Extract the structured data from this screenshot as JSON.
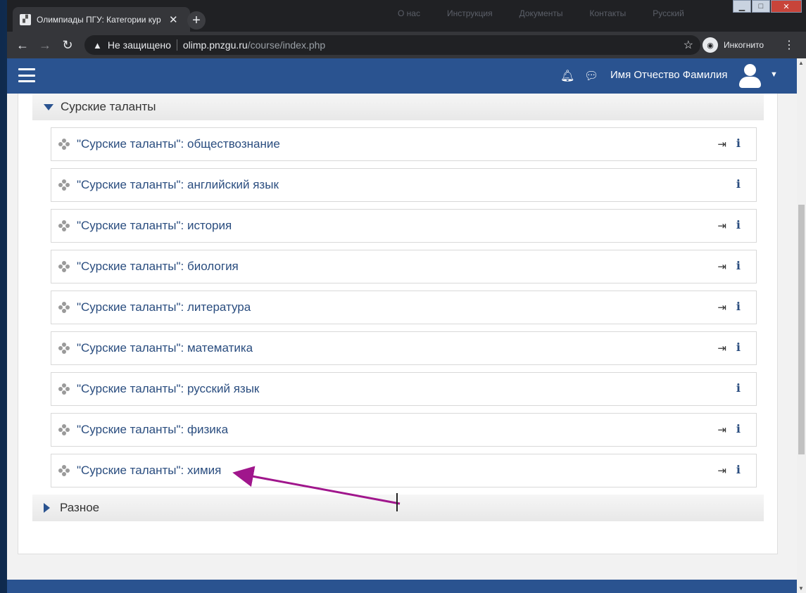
{
  "browser": {
    "tab_title": "Олимпиады ПГУ: Категории кур",
    "tab_close": "✕",
    "new_tab": "+",
    "ghost_links": [
      "О нас",
      "Инструкция",
      "Документы",
      "Контакты",
      "Русский"
    ],
    "not_secure": "Не защищено",
    "url_host": "olimp.pnzgu.ru",
    "url_path": "/course/index.php",
    "incognito_label": "Инкогнито"
  },
  "navbar": {
    "user_name": "Имя Отчество Фамилия"
  },
  "categories": [
    {
      "title": "Сурские таланты",
      "expanded": true,
      "courses": [
        {
          "name": "\"Сурские таланты\": обществознание",
          "enrol": true
        },
        {
          "name": "\"Сурские таланты\": английский язык",
          "enrol": false
        },
        {
          "name": "\"Сурские таланты\": история",
          "enrol": true
        },
        {
          "name": "\"Сурские таланты\": биология",
          "enrol": true
        },
        {
          "name": "\"Сурские таланты\": литература",
          "enrol": true
        },
        {
          "name": "\"Сурские таланты\": математика",
          "enrol": true
        },
        {
          "name": "\"Сурские таланты\": русский язык",
          "enrol": false
        },
        {
          "name": "\"Сурские таланты\": физика",
          "enrol": true
        },
        {
          "name": "\"Сурские таланты\": химия",
          "enrol": true
        }
      ]
    },
    {
      "title": "Разное",
      "expanded": false
    }
  ],
  "colors": {
    "navbar": "#2a5390",
    "link": "#2a4d7f",
    "annotation_arrow": "#a0168c"
  }
}
